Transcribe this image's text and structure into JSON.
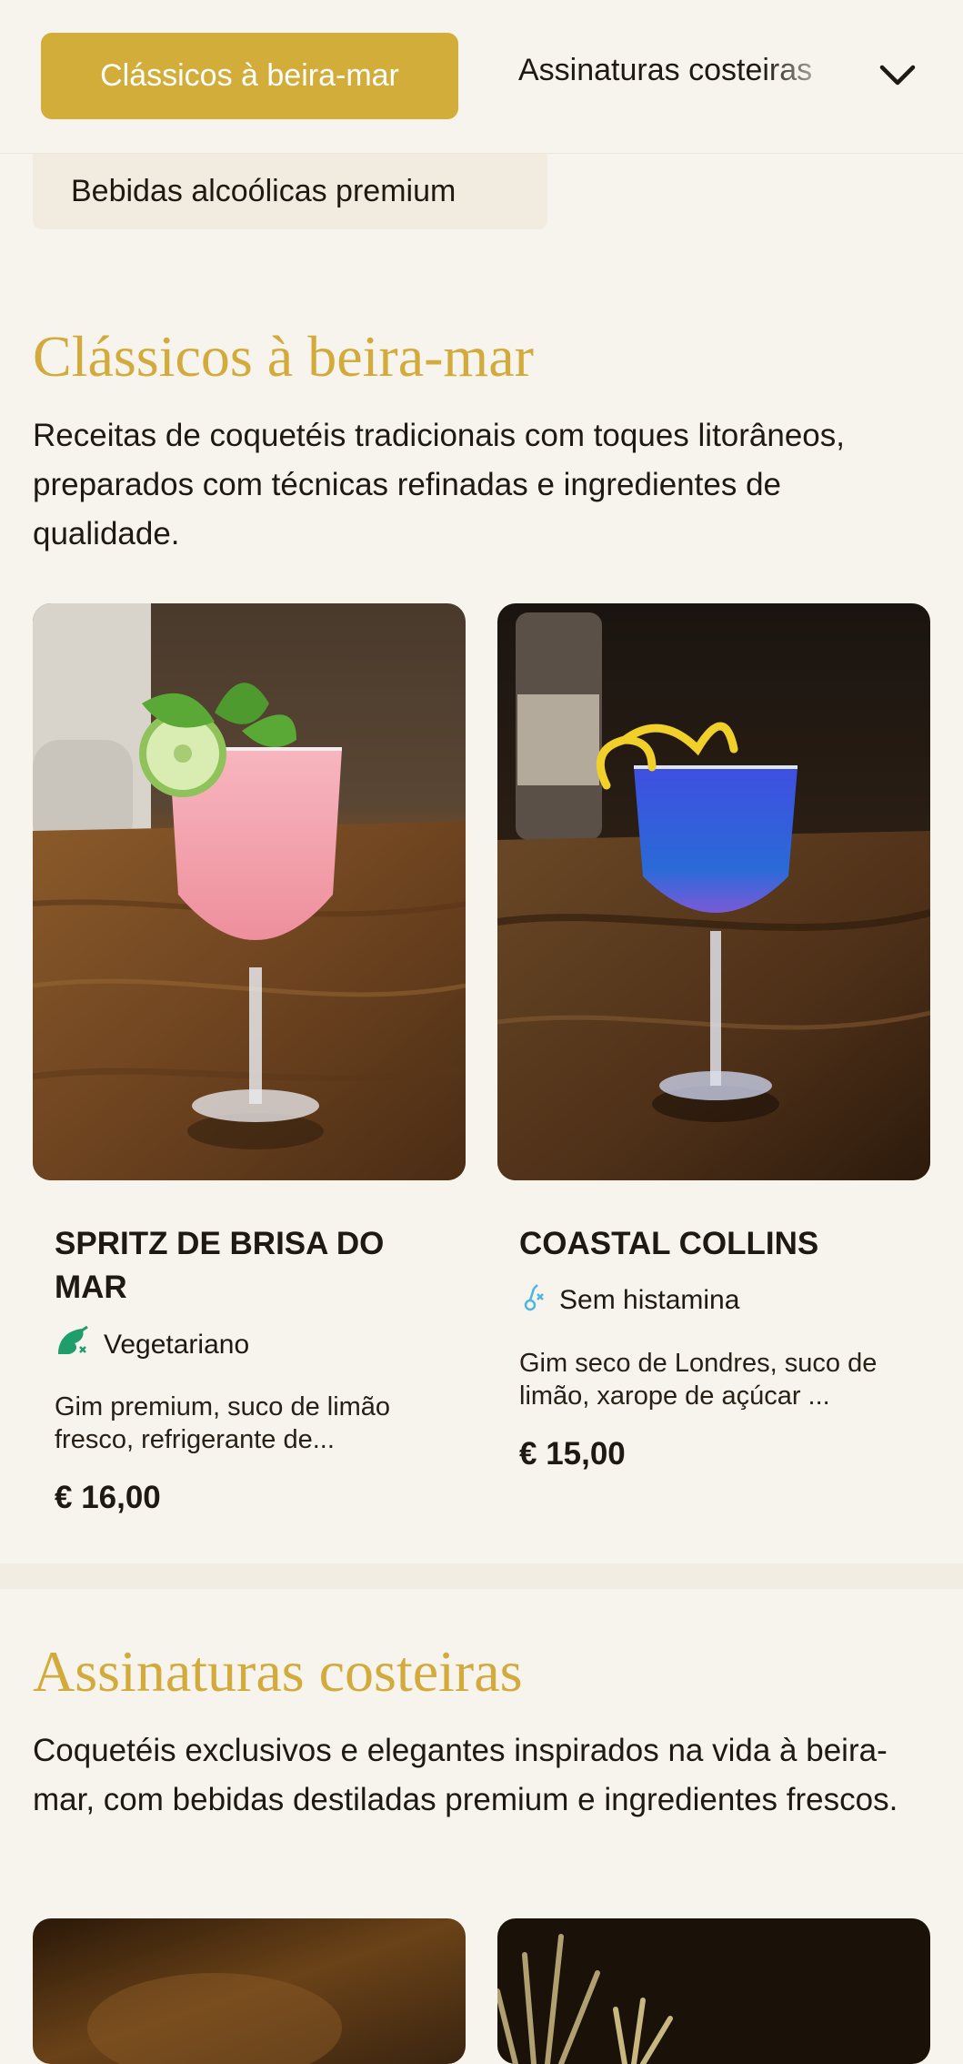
{
  "tabs": {
    "active": "Clássicos à beira-mar",
    "next": "Assinaturas costeiras",
    "third": "Bebidas alcoólicas premium"
  },
  "sections": [
    {
      "title": "Clássicos à beira-mar",
      "description": "Receitas de coquetéis tradicionais com toques litorâneos, preparados com técnicas refinadas e ingredientes de qualidade.",
      "items": [
        {
          "name": "SPRITZ DE BRISA DO MAR",
          "tag": "Vegetariano",
          "tag_icon": "vegetarian-icon",
          "description": "Gim premium, suco de limão fresco, refrigerante de...",
          "price": "€ 16,00",
          "image": "pink-spritz-cocktail-photo"
        },
        {
          "name": "COASTAL COLLINS",
          "tag": "Sem histamina",
          "tag_icon": "histamine-free-icon",
          "description": "Gim seco de Londres, suco de limão, xarope de açúcar ...",
          "price": "€ 15,00",
          "image": "blue-gin-cocktail-photo"
        }
      ]
    },
    {
      "title": "Assinaturas costeiras",
      "description": "Coquetéis exclusivos e elegantes inspirados na vida à beira-mar, com bebidas destiladas premium e ingredientes frescos.",
      "items": [
        {
          "image": "signature-cocktail-photo-1"
        },
        {
          "image": "signature-cocktail-photo-2"
        }
      ]
    }
  ],
  "colors": {
    "accent": "#d3ad3a",
    "background": "#f7f4ee",
    "vegetarian": "#1f9d6b",
    "histamine": "#4fb6e0"
  }
}
